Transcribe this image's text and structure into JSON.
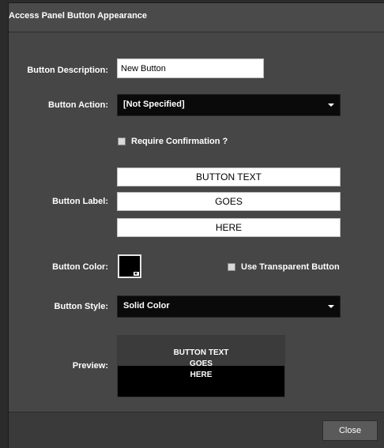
{
  "dialog": {
    "title": "Access Panel Button Appearance",
    "close_label": "Close"
  },
  "form": {
    "description_label": "Button Description:",
    "description_value": "New Button",
    "action_label": "Button Action:",
    "action_value": "[Not Specified]",
    "require_confirmation_label": "Require Confirmation ?",
    "require_confirmation_checked": false,
    "button_label_label": "Button Label:",
    "label_lines": [
      "BUTTON TEXT",
      "GOES",
      "HERE"
    ],
    "color_label": "Button Color:",
    "color_value": "#000000",
    "transparent_label": "Use Transparent Button",
    "transparent_checked": false,
    "style_label": "Button Style:",
    "style_value": "Solid Color",
    "preview_label": "Preview:"
  },
  "preview": {
    "lines": [
      "BUTTON TEXT",
      "GOES",
      "HERE"
    ]
  },
  "colors": {
    "dialog_bg": "#464646",
    "input_bg": "#ffffff",
    "select_bg": "#0a0a0a",
    "preview_bg": "#000000"
  },
  "icons": {
    "action_dropdown": "chevron-down-icon",
    "style_dropdown": "chevron-down-icon",
    "color_swatch": "color-picker-icon"
  }
}
